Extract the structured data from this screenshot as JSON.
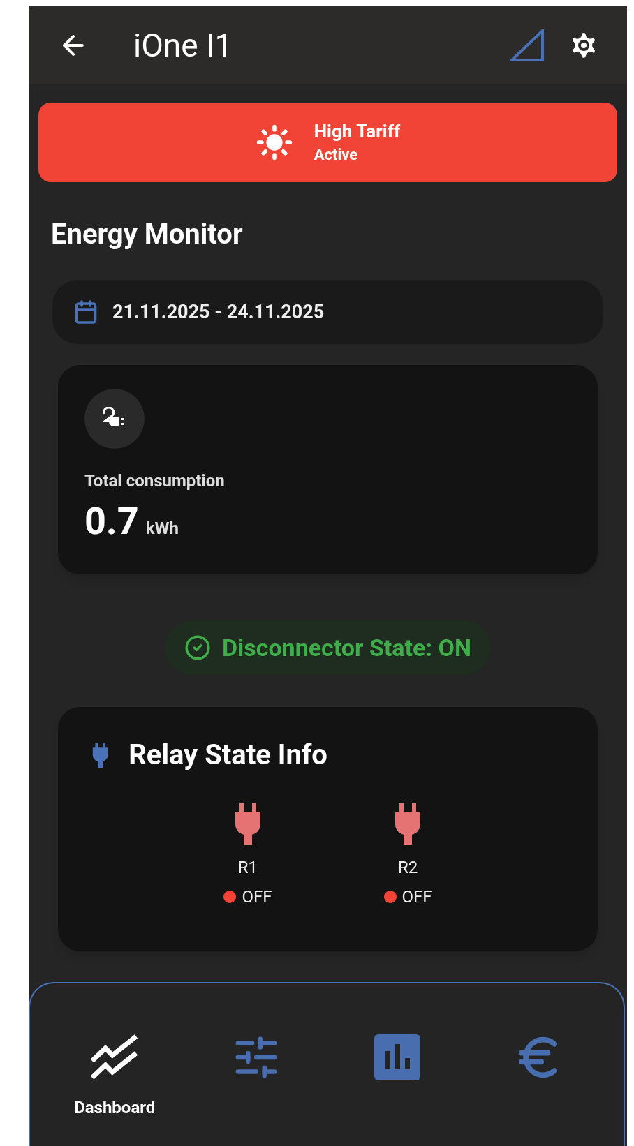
{
  "app_bar": {
    "title": "iOne I1"
  },
  "banner": {
    "title": "High Tariff",
    "status": "Active",
    "active": true
  },
  "section_title": "Energy Monitor",
  "date_range": "21.11.2025 - 24.11.2025",
  "consumption": {
    "label": "Total consumption",
    "value": "0.7",
    "unit": "kWh"
  },
  "disconnector": {
    "text": "Disconnector State: ON",
    "on": true
  },
  "relay_card": {
    "title": "Relay State Info",
    "relays": [
      {
        "name": "R1",
        "state": "OFF",
        "on": false
      },
      {
        "name": "R2",
        "state": "OFF",
        "on": false
      }
    ]
  },
  "nav": [
    {
      "kind": "dashboard",
      "label": "Dashboard",
      "selected": true
    },
    {
      "kind": "controls",
      "selected": false
    },
    {
      "kind": "chart",
      "selected": false
    },
    {
      "kind": "euro",
      "selected": false
    }
  ]
}
